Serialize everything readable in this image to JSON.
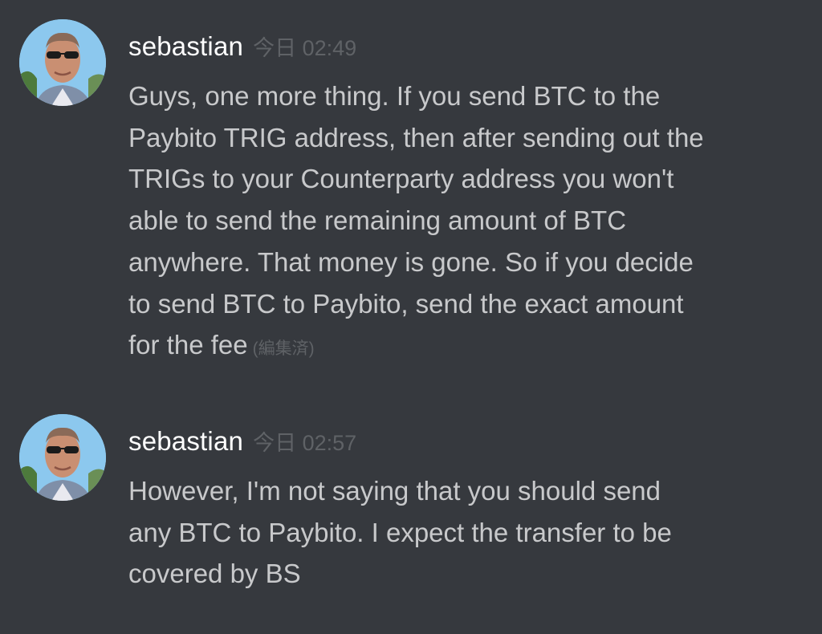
{
  "messages": [
    {
      "username": "sebastian",
      "timestamp": "今日 02:49",
      "content": "Guys, one more thing. If you send BTC to the\nPaybito TRIG address, then after sending out the\nTRIGs to your Counterparty address you won't\nable to send the remaining amount of BTC\nanywhere. That money is gone. So if you decide\nto send BTC to Paybito, send the exact amount\nfor the fee",
      "edited": "(編集済)"
    },
    {
      "username": "sebastian",
      "timestamp": "今日 02:57",
      "content": "However, I'm not saying that you should send\nany BTC to Paybito. I expect the transfer to be\ncovered by BS"
    }
  ],
  "colors": {
    "background": "#36393e",
    "username": "#ffffff",
    "message_text": "#c8c9cb",
    "muted": "#5f6266"
  }
}
